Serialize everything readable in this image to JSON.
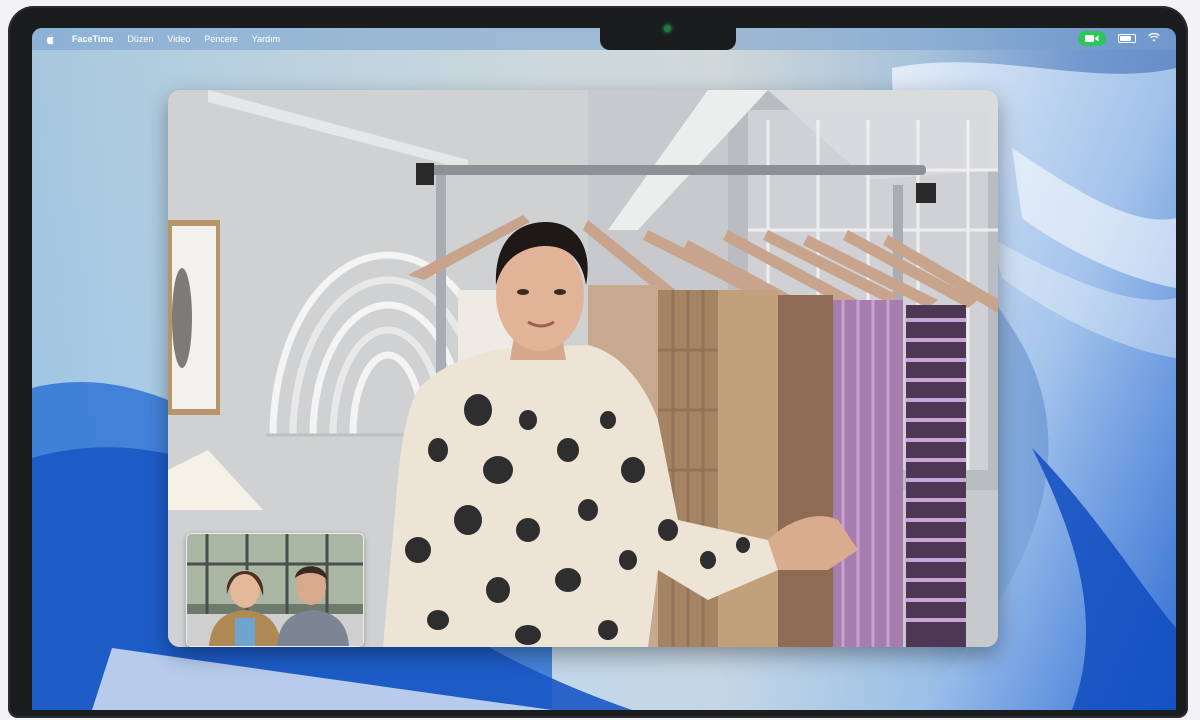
{
  "menubar": {
    "app_name": "FaceTime",
    "items": [
      "Düzen",
      "Video",
      "Pencere",
      "Yardım"
    ]
  },
  "status": {
    "camera_active_color": "#2dc65b"
  },
  "icons": {
    "apple": "apple-icon",
    "camera": "video-camera-icon",
    "battery": "battery-icon",
    "wifi": "wifi-icon"
  },
  "window": {
    "app": "FaceTime"
  }
}
